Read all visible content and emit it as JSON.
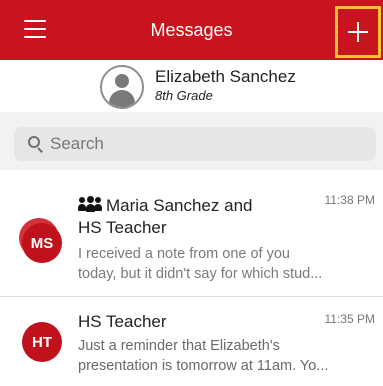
{
  "header": {
    "title": "Messages",
    "menu_icon": "hamburger-menu-icon",
    "compose_icon": "plus-icon",
    "background": "#c8141f",
    "highlight": "#f5c32c"
  },
  "student": {
    "name": "Elizabeth Sanchez",
    "grade": "8th Grade"
  },
  "search": {
    "placeholder": "Search",
    "value": ""
  },
  "messages": [
    {
      "initials": "MS",
      "title_line1": "Maria Sanchez and",
      "title_line2": "HS Teacher",
      "is_group": true,
      "time": "11:38 PM",
      "preview_line1": "I received a note from one of you",
      "preview_line2": "today, but it didn't say for which stud..."
    },
    {
      "initials": "HT",
      "title_line1": "HS Teacher",
      "is_group": false,
      "time": "11:35 PM",
      "preview_line1": "Just a reminder that Elizabeth's",
      "preview_line2": "presentation is tomorrow at 11am. Yo..."
    }
  ]
}
